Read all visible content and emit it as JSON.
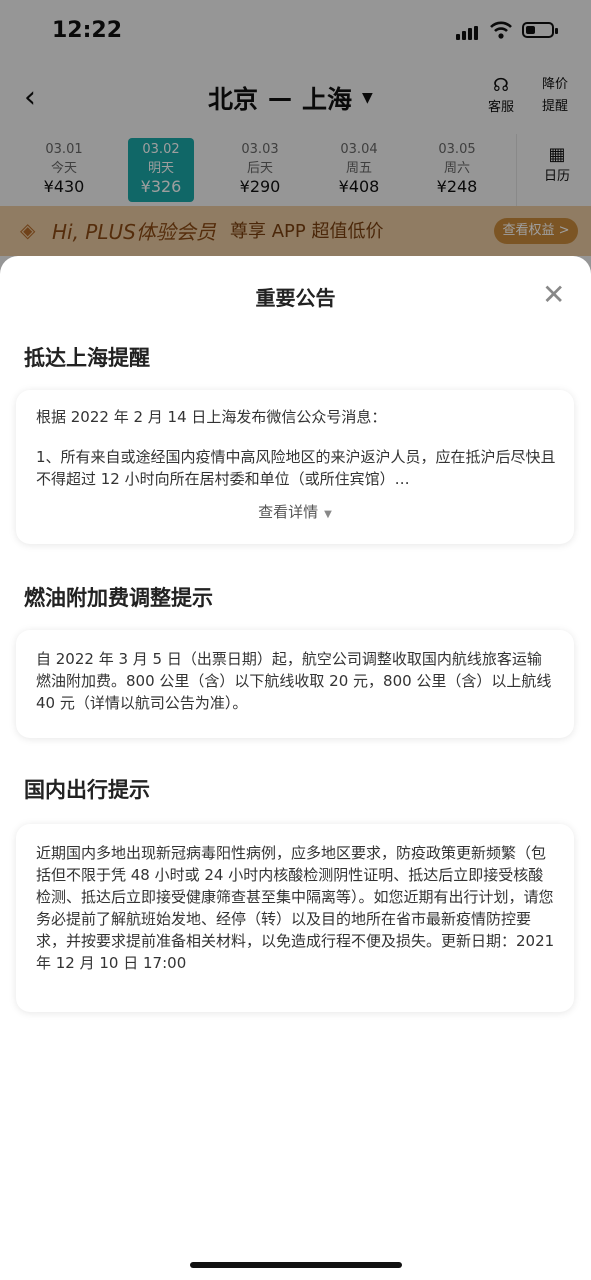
{
  "status_bar": {
    "time": "12:22"
  },
  "nav": {
    "back_icon": "chevron-left-icon",
    "from": "北京",
    "separator": "—",
    "to": "上海",
    "service_label": "客服",
    "alert_line1": "降价",
    "alert_line2": "提醒"
  },
  "dates": [
    {
      "date": "03.01",
      "label": "今天",
      "price": "¥430",
      "active": false
    },
    {
      "date": "03.02",
      "label": "明天",
      "price": "¥326",
      "active": true
    },
    {
      "date": "03.03",
      "label": "后天",
      "price": "¥290",
      "active": false
    },
    {
      "date": "03.04",
      "label": "周五",
      "price": "¥408",
      "active": false
    },
    {
      "date": "03.05",
      "label": "周六",
      "price": "¥248",
      "active": false
    }
  ],
  "calendar_label": "日历",
  "plus_banner": {
    "title": "Hi, PLUS体验会员",
    "subtitle": "尊享 APP 超值低价",
    "button": "查看权益 >"
  },
  "modal": {
    "title": "重要公告",
    "sections": [
      {
        "title": "抵达上海提醒",
        "paragraphs": [
          "根据 2022 年 2 月 14 日上海发布微信公众号消息：",
          "1、所有来自或途经国内疫情中高风险地区的来沪返沪人员，应在抵沪后尽快且不得超过 12 小时向所在居村委和单位（或所住宾馆）…"
        ],
        "more": "查看详情"
      },
      {
        "title": "燃油附加费调整提示",
        "paragraphs": [
          "自 2022 年 3 月 5 日（出票日期）起，航空公司调整收取国内航线旅客运输燃油附加费。800 公里（含）以下航线收取 20 元，800 公里（含）以上航线 40 元（详情以航司公告为准）。"
        ]
      },
      {
        "title": "国内出行提示",
        "paragraphs": [
          "近期国内多地出现新冠病毒阳性病例，应多地区要求，防疫政策更新频繁（包括但不限于凭 48 小时或 24 小时内核酸检测阴性证明、抵达后立即接受核酸检测、抵达后立即接受健康筛查甚至集中隔离等）。如您近期有出行计划，请您务必提前了解航班始发地、经停（转）以及目的地所在省市最新疫情防控要求，并按要求提前准备相关材料，以免造成行程不便及损失。更新日期：2021 年 12 月 10 日 17:00"
        ]
      }
    ]
  },
  "colors": {
    "accent": "#1aa6a6",
    "plus_bg": "#e8c9a0",
    "plus_btn": "#c98a3a"
  }
}
